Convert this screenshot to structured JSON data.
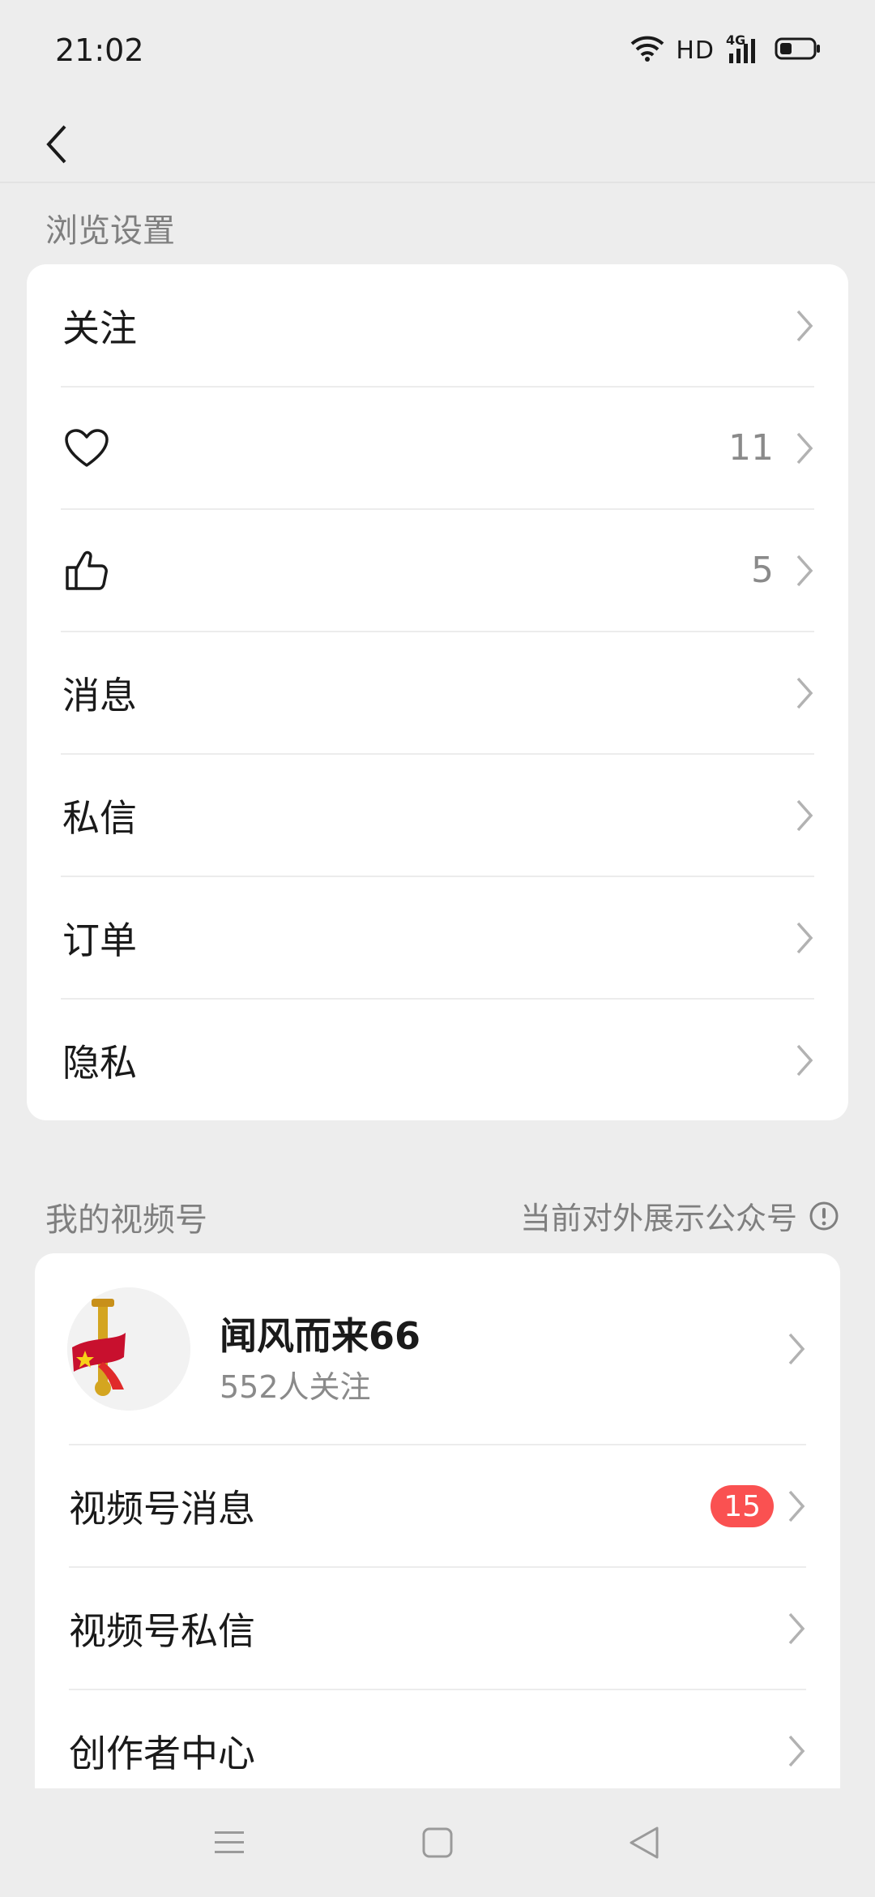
{
  "status": {
    "time": "21:02",
    "hd": "HD",
    "network": "4G"
  },
  "browse_section": {
    "title": "浏览设置",
    "items": [
      {
        "label": "关注",
        "icon": null,
        "count": ""
      },
      {
        "label": "",
        "icon": "heart-icon",
        "count": "11"
      },
      {
        "label": "",
        "icon": "thumbs-up-icon",
        "count": "5"
      },
      {
        "label": "消息",
        "icon": null,
        "count": ""
      },
      {
        "label": "私信",
        "icon": null,
        "count": ""
      },
      {
        "label": "订单",
        "icon": null,
        "count": ""
      },
      {
        "label": "隐私",
        "icon": null,
        "count": ""
      }
    ]
  },
  "video_section": {
    "title": "我的视频号",
    "right_label": "当前对外展示公众号",
    "profile": {
      "name": "闻风而来66",
      "followers": "552人关注"
    },
    "items": [
      {
        "label": "视频号消息",
        "badge": "15"
      },
      {
        "label": "视频号私信",
        "badge": ""
      },
      {
        "label": "创作者中心",
        "badge": ""
      }
    ]
  },
  "colors": {
    "background": "#ededed",
    "card": "#ffffff",
    "badge": "#fa5151",
    "secondary_text": "#8a8a8a"
  }
}
